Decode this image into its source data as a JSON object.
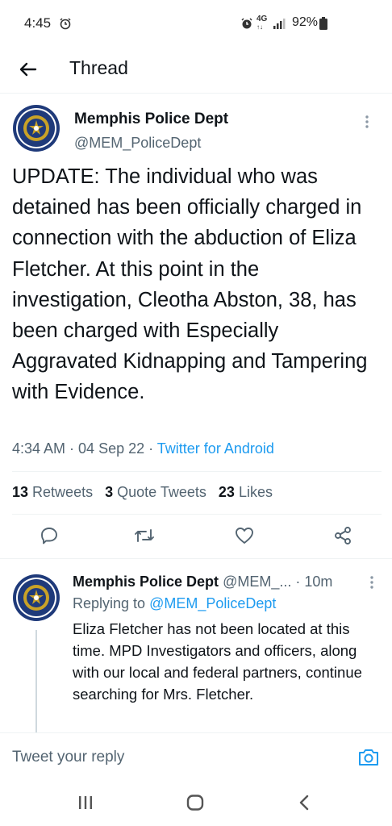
{
  "status_bar": {
    "time": "4:45",
    "battery_pct": "92%"
  },
  "header": {
    "title": "Thread"
  },
  "main_tweet": {
    "name": "Memphis Police Dept",
    "handle": "@MEM_PoliceDept",
    "text": "UPDATE: The individual who was detained has been officially charged in connection with the abduction of Eliza Fletcher. At this point in the investigation, Cleotha Abston, 38, has been charged with Especially Aggravated Kidnapping and Tampering with Evidence.",
    "time": "4:34 AM",
    "sep1": " · ",
    "date": "04 Sep 22",
    "sep2": " · ",
    "source": "Twitter for Android",
    "stats": {
      "retweets_count": "13",
      "retweets_label": "Retweets",
      "quotes_count": "3",
      "quotes_label": "Quote Tweets",
      "likes_count": "23",
      "likes_label": "Likes"
    }
  },
  "reply_tweet": {
    "name": "Memphis Police Dept",
    "handle_truncated": "@MEM_...",
    "sep": " · ",
    "age": "10m",
    "replying_label": "Replying to",
    "replying_to": "@MEM_PoliceDept",
    "text": "Eliza Fletcher has not been located at this time. MPD Investigators and officers, along with our local and federal partners, continue searching for Mrs. Fletcher."
  },
  "compose": {
    "placeholder": "Tweet your reply"
  },
  "icons": {
    "back": "arrow-left-icon",
    "more": "more-vertical-icon",
    "reply": "reply-icon",
    "retweet": "retweet-icon",
    "like": "heart-icon",
    "share": "share-icon",
    "camera": "camera-icon"
  },
  "colors": {
    "accent": "#1d9bf0",
    "text": "#0f1419",
    "secondary": "#536471",
    "divider": "#eff3f4"
  }
}
